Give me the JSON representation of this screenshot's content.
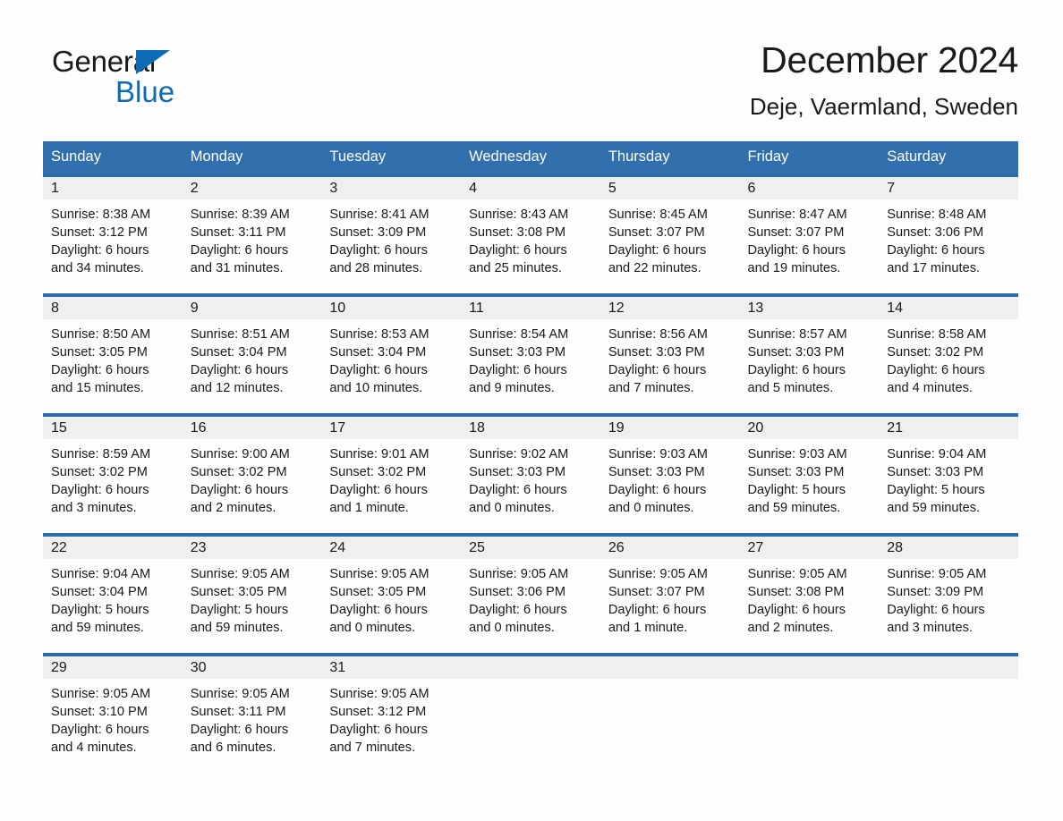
{
  "brand": {
    "name_part1": "General",
    "name_part2": "Blue",
    "triangle_icon": "triangle-icon",
    "accent_color": "#0c6cb5"
  },
  "header": {
    "title": "December 2024",
    "location": "Deje, Vaermland, Sweden"
  },
  "calendar": {
    "header_bg": "#316fad",
    "row_border_color": "#2b6cab",
    "daynum_band_bg": "#efefef",
    "weekdays": [
      "Sunday",
      "Monday",
      "Tuesday",
      "Wednesday",
      "Thursday",
      "Friday",
      "Saturday"
    ],
    "weeks": [
      [
        {
          "day": "1",
          "sunrise": "Sunrise: 8:38 AM",
          "sunset": "Sunset: 3:12 PM",
          "daylight_line1": "Daylight: 6 hours",
          "daylight_line2": "and 34 minutes."
        },
        {
          "day": "2",
          "sunrise": "Sunrise: 8:39 AM",
          "sunset": "Sunset: 3:11 PM",
          "daylight_line1": "Daylight: 6 hours",
          "daylight_line2": "and 31 minutes."
        },
        {
          "day": "3",
          "sunrise": "Sunrise: 8:41 AM",
          "sunset": "Sunset: 3:09 PM",
          "daylight_line1": "Daylight: 6 hours",
          "daylight_line2": "and 28 minutes."
        },
        {
          "day": "4",
          "sunrise": "Sunrise: 8:43 AM",
          "sunset": "Sunset: 3:08 PM",
          "daylight_line1": "Daylight: 6 hours",
          "daylight_line2": "and 25 minutes."
        },
        {
          "day": "5",
          "sunrise": "Sunrise: 8:45 AM",
          "sunset": "Sunset: 3:07 PM",
          "daylight_line1": "Daylight: 6 hours",
          "daylight_line2": "and 22 minutes."
        },
        {
          "day": "6",
          "sunrise": "Sunrise: 8:47 AM",
          "sunset": "Sunset: 3:07 PM",
          "daylight_line1": "Daylight: 6 hours",
          "daylight_line2": "and 19 minutes."
        },
        {
          "day": "7",
          "sunrise": "Sunrise: 8:48 AM",
          "sunset": "Sunset: 3:06 PM",
          "daylight_line1": "Daylight: 6 hours",
          "daylight_line2": "and 17 minutes."
        }
      ],
      [
        {
          "day": "8",
          "sunrise": "Sunrise: 8:50 AM",
          "sunset": "Sunset: 3:05 PM",
          "daylight_line1": "Daylight: 6 hours",
          "daylight_line2": "and 15 minutes."
        },
        {
          "day": "9",
          "sunrise": "Sunrise: 8:51 AM",
          "sunset": "Sunset: 3:04 PM",
          "daylight_line1": "Daylight: 6 hours",
          "daylight_line2": "and 12 minutes."
        },
        {
          "day": "10",
          "sunrise": "Sunrise: 8:53 AM",
          "sunset": "Sunset: 3:04 PM",
          "daylight_line1": "Daylight: 6 hours",
          "daylight_line2": "and 10 minutes."
        },
        {
          "day": "11",
          "sunrise": "Sunrise: 8:54 AM",
          "sunset": "Sunset: 3:03 PM",
          "daylight_line1": "Daylight: 6 hours",
          "daylight_line2": "and 9 minutes."
        },
        {
          "day": "12",
          "sunrise": "Sunrise: 8:56 AM",
          "sunset": "Sunset: 3:03 PM",
          "daylight_line1": "Daylight: 6 hours",
          "daylight_line2": "and 7 minutes."
        },
        {
          "day": "13",
          "sunrise": "Sunrise: 8:57 AM",
          "sunset": "Sunset: 3:03 PM",
          "daylight_line1": "Daylight: 6 hours",
          "daylight_line2": "and 5 minutes."
        },
        {
          "day": "14",
          "sunrise": "Sunrise: 8:58 AM",
          "sunset": "Sunset: 3:02 PM",
          "daylight_line1": "Daylight: 6 hours",
          "daylight_line2": "and 4 minutes."
        }
      ],
      [
        {
          "day": "15",
          "sunrise": "Sunrise: 8:59 AM",
          "sunset": "Sunset: 3:02 PM",
          "daylight_line1": "Daylight: 6 hours",
          "daylight_line2": "and 3 minutes."
        },
        {
          "day": "16",
          "sunrise": "Sunrise: 9:00 AM",
          "sunset": "Sunset: 3:02 PM",
          "daylight_line1": "Daylight: 6 hours",
          "daylight_line2": "and 2 minutes."
        },
        {
          "day": "17",
          "sunrise": "Sunrise: 9:01 AM",
          "sunset": "Sunset: 3:02 PM",
          "daylight_line1": "Daylight: 6 hours",
          "daylight_line2": "and 1 minute."
        },
        {
          "day": "18",
          "sunrise": "Sunrise: 9:02 AM",
          "sunset": "Sunset: 3:03 PM",
          "daylight_line1": "Daylight: 6 hours",
          "daylight_line2": "and 0 minutes."
        },
        {
          "day": "19",
          "sunrise": "Sunrise: 9:03 AM",
          "sunset": "Sunset: 3:03 PM",
          "daylight_line1": "Daylight: 6 hours",
          "daylight_line2": "and 0 minutes."
        },
        {
          "day": "20",
          "sunrise": "Sunrise: 9:03 AM",
          "sunset": "Sunset: 3:03 PM",
          "daylight_line1": "Daylight: 5 hours",
          "daylight_line2": "and 59 minutes."
        },
        {
          "day": "21",
          "sunrise": "Sunrise: 9:04 AM",
          "sunset": "Sunset: 3:03 PM",
          "daylight_line1": "Daylight: 5 hours",
          "daylight_line2": "and 59 minutes."
        }
      ],
      [
        {
          "day": "22",
          "sunrise": "Sunrise: 9:04 AM",
          "sunset": "Sunset: 3:04 PM",
          "daylight_line1": "Daylight: 5 hours",
          "daylight_line2": "and 59 minutes."
        },
        {
          "day": "23",
          "sunrise": "Sunrise: 9:05 AM",
          "sunset": "Sunset: 3:05 PM",
          "daylight_line1": "Daylight: 5 hours",
          "daylight_line2": "and 59 minutes."
        },
        {
          "day": "24",
          "sunrise": "Sunrise: 9:05 AM",
          "sunset": "Sunset: 3:05 PM",
          "daylight_line1": "Daylight: 6 hours",
          "daylight_line2": "and 0 minutes."
        },
        {
          "day": "25",
          "sunrise": "Sunrise: 9:05 AM",
          "sunset": "Sunset: 3:06 PM",
          "daylight_line1": "Daylight: 6 hours",
          "daylight_line2": "and 0 minutes."
        },
        {
          "day": "26",
          "sunrise": "Sunrise: 9:05 AM",
          "sunset": "Sunset: 3:07 PM",
          "daylight_line1": "Daylight: 6 hours",
          "daylight_line2": "and 1 minute."
        },
        {
          "day": "27",
          "sunrise": "Sunrise: 9:05 AM",
          "sunset": "Sunset: 3:08 PM",
          "daylight_line1": "Daylight: 6 hours",
          "daylight_line2": "and 2 minutes."
        },
        {
          "day": "28",
          "sunrise": "Sunrise: 9:05 AM",
          "sunset": "Sunset: 3:09 PM",
          "daylight_line1": "Daylight: 6 hours",
          "daylight_line2": "and 3 minutes."
        }
      ],
      [
        {
          "day": "29",
          "sunrise": "Sunrise: 9:05 AM",
          "sunset": "Sunset: 3:10 PM",
          "daylight_line1": "Daylight: 6 hours",
          "daylight_line2": "and 4 minutes."
        },
        {
          "day": "30",
          "sunrise": "Sunrise: 9:05 AM",
          "sunset": "Sunset: 3:11 PM",
          "daylight_line1": "Daylight: 6 hours",
          "daylight_line2": "and 6 minutes."
        },
        {
          "day": "31",
          "sunrise": "Sunrise: 9:05 AM",
          "sunset": "Sunset: 3:12 PM",
          "daylight_line1": "Daylight: 6 hours",
          "daylight_line2": "and 7 minutes."
        },
        {
          "day": "",
          "sunrise": "",
          "sunset": "",
          "daylight_line1": "",
          "daylight_line2": ""
        },
        {
          "day": "",
          "sunrise": "",
          "sunset": "",
          "daylight_line1": "",
          "daylight_line2": ""
        },
        {
          "day": "",
          "sunrise": "",
          "sunset": "",
          "daylight_line1": "",
          "daylight_line2": ""
        },
        {
          "day": "",
          "sunrise": "",
          "sunset": "",
          "daylight_line1": "",
          "daylight_line2": ""
        }
      ]
    ]
  }
}
